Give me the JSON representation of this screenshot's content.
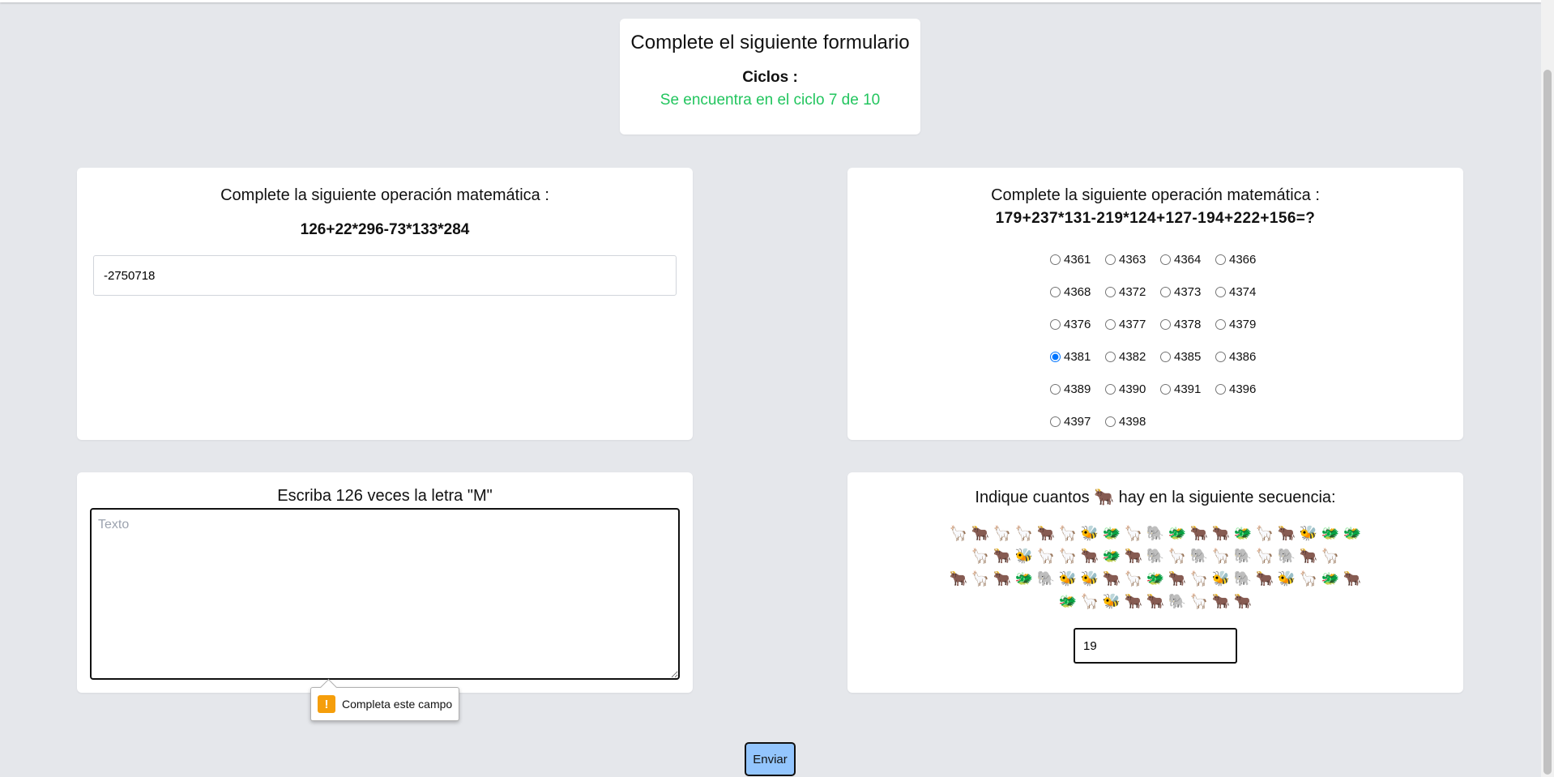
{
  "header": {
    "title": "Complete el siguiente formulario",
    "cycles_label": "Ciclos :",
    "cycle_status": "Se encuentra en el ciclo 7 de 10"
  },
  "q1": {
    "title": "Complete la siguiente operación matemática :",
    "operation": "126+22*296-73*133*284",
    "answer_value": "-2750718"
  },
  "q2": {
    "title": "Complete la siguiente operación matemática :",
    "operation": "179+237*131-219*124+127-194+222+156=?",
    "options": [
      [
        "4361",
        "4363",
        "4364",
        "4366"
      ],
      [
        "4368",
        "4372",
        "4373",
        "4374"
      ],
      [
        "4376",
        "4377",
        "4378",
        "4379"
      ],
      [
        "4381",
        "4382",
        "4385",
        "4386"
      ],
      [
        "4389",
        "4390",
        "4391",
        "4396"
      ],
      [
        "4397",
        "4398"
      ]
    ],
    "selected": "4381"
  },
  "q3": {
    "title": "Escriba 126 veces la letra \"M\"",
    "placeholder": "Texto",
    "value": ""
  },
  "q4": {
    "title": "Indique cuantos 🐂 hay en la siguiente secuencia:",
    "sequence": [
      [
        "🦙",
        "🐂",
        "🦙",
        "🦙",
        "🐂",
        "🦙",
        "🐝",
        "🐲",
        "🦙",
        "🐘",
        "🐲",
        "🐂",
        "🐂",
        "🐲",
        "🦙",
        "🐂",
        "🐝",
        "🐲",
        "🐲"
      ],
      [
        "🦙",
        "🐂",
        "🐝",
        "🦙",
        "🦙",
        "🐂",
        "🐲",
        "🐂",
        "🐘",
        "🦙",
        "🐘",
        "🦙",
        "🐘",
        "🦙",
        "🐘",
        "🐂",
        "🦙"
      ],
      [
        "🐂",
        "🦙",
        "🐂",
        "🐲",
        "🐘",
        "🐝",
        "🐝",
        "🐂",
        "🦙",
        "🐲",
        "🐂",
        "🦙",
        "🐝",
        "🐘",
        "🐂",
        "🐝",
        "🦙",
        "🐲",
        "🐂"
      ],
      [
        "🐲",
        "🦙",
        "🐝",
        "🐂",
        "🐂",
        "🐘",
        "🦙",
        "🐂",
        "🐂"
      ]
    ],
    "answer_value": "19"
  },
  "tooltip": {
    "text": "Completa este campo",
    "icon": "warning-icon"
  },
  "submit": {
    "label": "Enviar"
  },
  "colors": {
    "status": "#22c55e",
    "button": "#93c5fd",
    "background": "#e5e7eb"
  }
}
